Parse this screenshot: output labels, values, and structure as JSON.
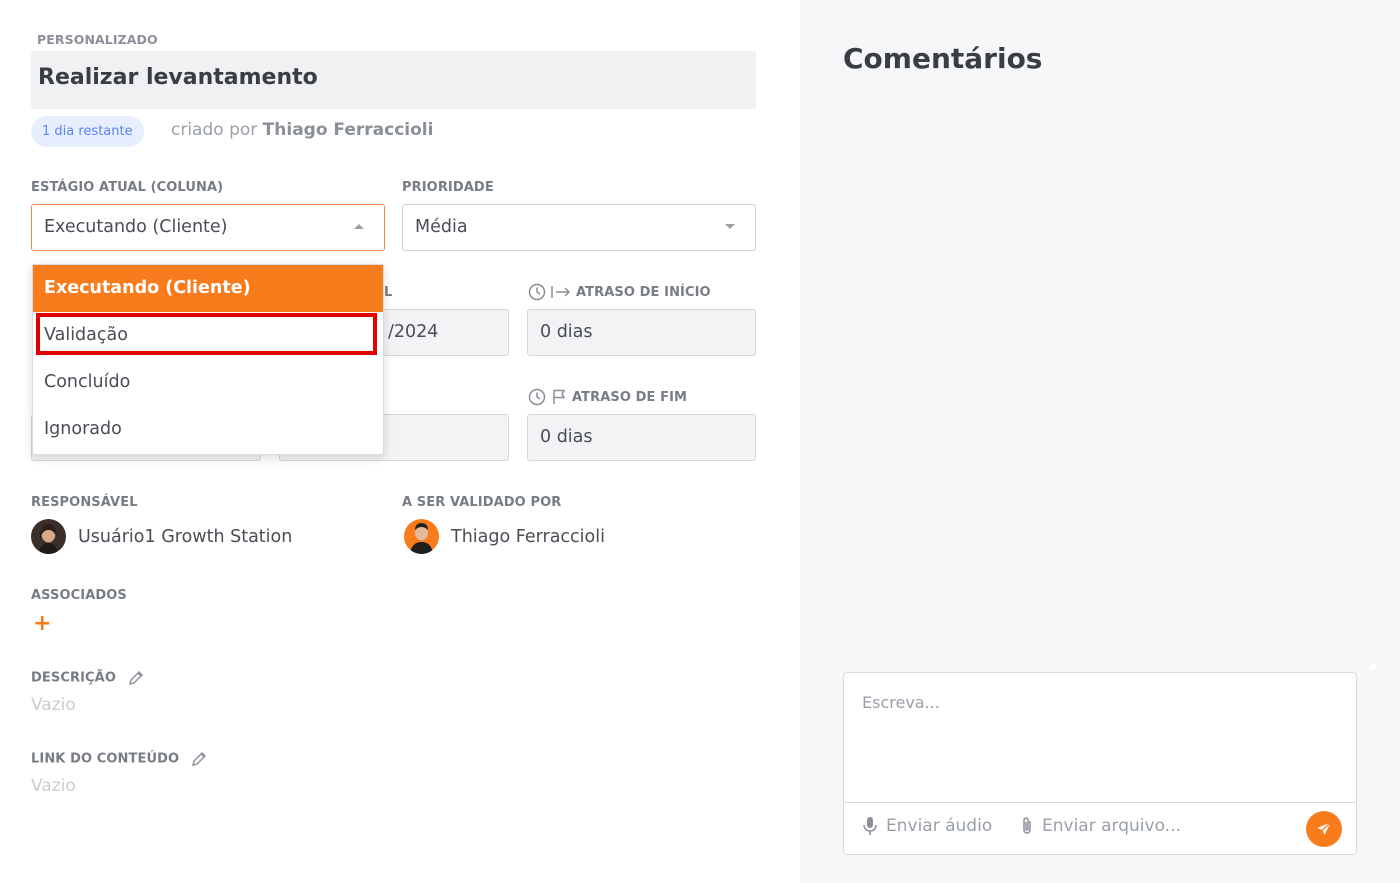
{
  "task": {
    "category": "PERSONALIZADO",
    "title": "Realizar levantamento",
    "deadline_badge": "1 dia restante",
    "created_by_prefix": "criado por",
    "created_by_name": "Thiago Ferraccioli"
  },
  "stage": {
    "label": "ESTÁGIO ATUAL (COLUNA)",
    "value": "Executando (Cliente)",
    "options": [
      "Executando (Cliente)",
      "Validação",
      "Concluído",
      "Ignorado"
    ],
    "highlighted_option": "Validação"
  },
  "priority": {
    "label": "PRIORIDADE",
    "value": "Média"
  },
  "dates": {
    "partial_label_fragment": "L",
    "partial_date_fragment": "/2024",
    "start_delay_label": "ATRASO DE INÍCIO",
    "start_delay_value": "0 dias",
    "end_delay_label": "ATRASO DE FIM",
    "end_delay_value": "0 dias"
  },
  "people": {
    "responsible_label": "RESPONSÁVEL",
    "responsible_name": "Usuário1 Growth Station",
    "validator_label": "A SER VALIDADO POR",
    "validator_name": "Thiago Ferraccioli"
  },
  "associated": {
    "label": "ASSOCIADOS",
    "add_symbol": "+"
  },
  "description": {
    "label": "DESCRIÇÃO",
    "value": "Vazio"
  },
  "content_link": {
    "label": "LINK DO CONTEÚDO",
    "value": "Vazio"
  },
  "comments": {
    "title": "Comentários",
    "placeholder": "Escreva...",
    "send_audio": "Enviar áudio",
    "send_file": "Enviar arquivo..."
  },
  "colors": {
    "accent": "#f97c1c",
    "highlight_border": "#e00000",
    "badge_bg": "#e7efff",
    "badge_text": "#5b83f0"
  }
}
